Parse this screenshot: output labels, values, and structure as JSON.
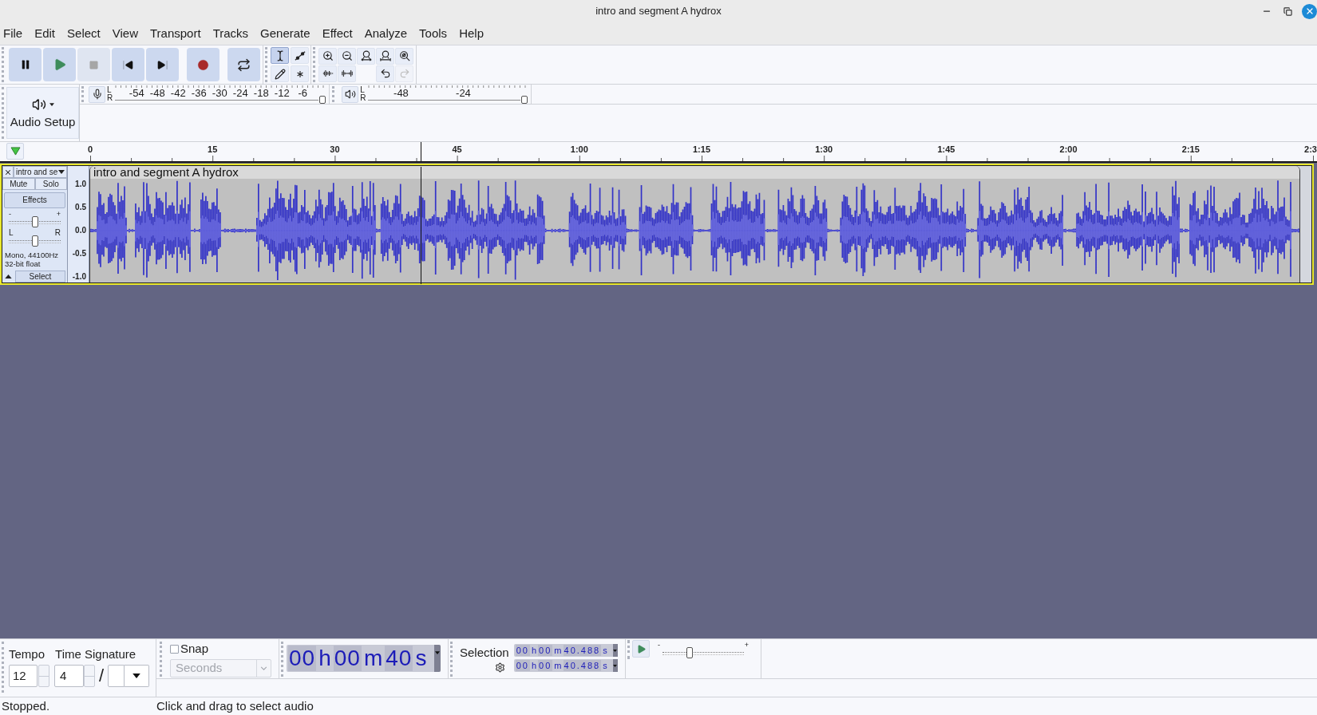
{
  "window": {
    "title": "intro and segment A hydrox"
  },
  "menu_bar": [
    "File",
    "Edit",
    "Select",
    "View",
    "Transport",
    "Tracks",
    "Generate",
    "Effect",
    "Analyze",
    "Tools",
    "Help"
  ],
  "transport": [
    {
      "kind": "pause",
      "disabled": false
    },
    {
      "kind": "play",
      "disabled": false
    },
    {
      "kind": "stop",
      "disabled": true
    },
    {
      "kind": "skip-start",
      "disabled": false
    },
    {
      "kind": "skip-end",
      "disabled": false
    },
    {
      "kind": "record",
      "disabled": false
    },
    {
      "kind": "loop",
      "disabled": false
    }
  ],
  "tools": [
    {
      "kind": "select",
      "selected": true
    },
    {
      "kind": "envelope",
      "selected": false
    },
    {
      "kind": "draw",
      "selected": false
    },
    {
      "kind": "multi",
      "selected": false
    }
  ],
  "edit_toolbar": [
    {
      "kind": "zoom-in",
      "disabled": false
    },
    {
      "kind": "zoom-out",
      "disabled": false
    },
    {
      "kind": "fit-selection",
      "disabled": false
    },
    {
      "kind": "fit-project",
      "disabled": false
    },
    {
      "kind": "zoom-toggle",
      "disabled": false
    },
    {
      "kind": "trim",
      "disabled": false
    },
    {
      "kind": "silence",
      "disabled": false
    },
    {
      "kind": "undo",
      "disabled": false
    },
    {
      "kind": "redo",
      "disabled": true
    }
  ],
  "audio_setup": {
    "label": "Audio Setup"
  },
  "recording_meter": {
    "channel_labels": [
      "L",
      "R"
    ],
    "ticks": [
      "-54",
      "-48",
      "-42",
      "-36",
      "-30",
      "-24",
      "-18",
      "-12",
      "-6"
    ],
    "level": 1
  },
  "playback_meter": {
    "channel_labels": [
      "L",
      "R"
    ],
    "ticks": [
      "-48",
      "-24"
    ],
    "level": 1
  },
  "ruler": {
    "labels": [
      "0",
      "15",
      "30",
      "45",
      "1:00",
      "1:15",
      "1:30",
      "1:45",
      "2:00",
      "2:15",
      "2:3"
    ]
  },
  "cursor": {
    "level": 0.2694
  },
  "track": {
    "name": "intro and se",
    "selected": true,
    "buttons": [
      {
        "label": "Mute",
        "on": false
      },
      {
        "label": "Solo",
        "on": false
      }
    ],
    "effects": "Effects",
    "gain": {
      "minus": "-",
      "plus": "+",
      "level": 0.5
    },
    "pan": {
      "left": "L",
      "right": "R",
      "level": 0.5
    },
    "format": [
      "Mono, 44100Hz",
      "32-bit float"
    ],
    "select": "Select",
    "scale": [
      "1.0",
      "0.5",
      "0.0",
      "-0.5",
      "-1.0"
    ],
    "clip": {
      "title": "intro and segment A hydrox"
    }
  },
  "bottom_toolbar": {
    "tempo": {
      "label": "Tempo",
      "value": "12"
    },
    "time_signature": {
      "label": "Time Signature",
      "numerator": "4",
      "separator": "/"
    },
    "snap": {
      "label": "Snap",
      "checked": false,
      "unit": "Seconds",
      "disabled": true
    },
    "time_display": {
      "segments": [
        {
          "digits": "00",
          "unit": "h"
        },
        {
          "digits": "00",
          "unit": "m"
        },
        {
          "digits": "40",
          "unit": "s"
        }
      ]
    },
    "selection": {
      "label": "Selection",
      "start": {
        "segments": [
          {
            "digits": "00",
            "unit": "h"
          },
          {
            "digits": "00",
            "unit": "m"
          },
          {
            "digits": "40.488",
            "unit": "s"
          }
        ]
      },
      "end": {
        "segments": [
          {
            "digits": "00",
            "unit": "h"
          },
          {
            "digits": "00",
            "unit": "m"
          },
          {
            "digits": "40.488",
            "unit": "s"
          }
        ]
      }
    },
    "play_at_speed": {
      "minus": "-",
      "plus": "+",
      "level": 0.32
    }
  },
  "status_bar": {
    "state": "Stopped.",
    "hint": "Click and drag to select audio"
  }
}
